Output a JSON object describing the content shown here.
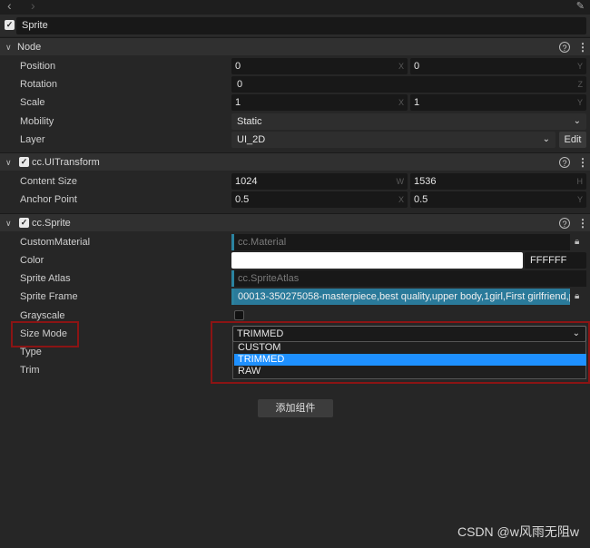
{
  "node_name": "Sprite",
  "sections": {
    "node": "Node",
    "uitransform": "cc.UITransform",
    "sprite": "cc.Sprite"
  },
  "node": {
    "position": {
      "label": "Position",
      "x": "0",
      "y": "0",
      "x_suffix": "X",
      "y_suffix": "Y"
    },
    "rotation": {
      "label": "Rotation",
      "z": "0",
      "z_suffix": "Z"
    },
    "scale": {
      "label": "Scale",
      "x": "1",
      "y": "1",
      "x_suffix": "X",
      "y_suffix": "Y"
    },
    "mobility": {
      "label": "Mobility",
      "value": "Static"
    },
    "layer": {
      "label": "Layer",
      "value": "UI_2D",
      "edit": "Edit"
    }
  },
  "uitransform": {
    "content_size": {
      "label": "Content Size",
      "w": "1024",
      "h": "1536",
      "w_suffix": "W",
      "h_suffix": "H"
    },
    "anchor_point": {
      "label": "Anchor Point",
      "x": "0.5",
      "y": "0.5",
      "x_suffix": "X",
      "y_suffix": "Y"
    }
  },
  "sprite": {
    "custom_material": {
      "label": "CustomMaterial",
      "value": "cc.Material"
    },
    "color": {
      "label": "Color",
      "hex": "FFFFFF",
      "swatch": "#ffffff"
    },
    "sprite_atlas": {
      "label": "Sprite Atlas",
      "value": "cc.SpriteAtlas"
    },
    "sprite_frame": {
      "label": "Sprite Frame",
      "value": "00013-350275058-masterpiece,best quality,upper body,1girl,First girlfriend,p..."
    },
    "grayscale": {
      "label": "Grayscale",
      "checked": false
    },
    "size_mode": {
      "label": "Size Mode",
      "value": "TRIMMED",
      "options": [
        "CUSTOM",
        "TRIMMED",
        "RAW"
      ],
      "selected": "TRIMMED"
    },
    "type": {
      "label": "Type"
    },
    "trim": {
      "label": "Trim"
    }
  },
  "add_component": "添加组件",
  "watermark": "CSDN @w风雨无阻w",
  "colors": {
    "highlight": "#1e90ff",
    "annotation_red": "#8b1414",
    "asset_accent": "#2b83a0"
  },
  "help_glyph": "?"
}
